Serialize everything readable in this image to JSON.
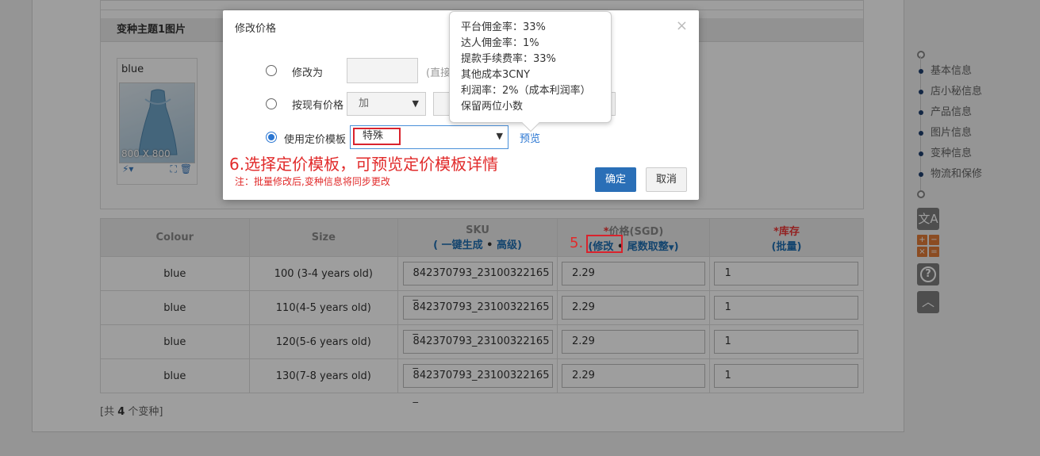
{
  "variant_section": {
    "header": "变种主题1图片",
    "image_card": {
      "label": "blue",
      "size_text": "800 X 800"
    }
  },
  "table": {
    "columns": {
      "colour": "Colour",
      "size": "Size",
      "sku": "SKU",
      "sku_sub_open": "( ",
      "sku_generate": "一键生成",
      "sku_dot": " • ",
      "sku_advanced": "高级",
      "sku_sub_close": ")",
      "price_star": "*",
      "price": "价格(SGD)",
      "price_open": "(",
      "price_edit": "修改",
      "price_dot": " • ",
      "price_round": "尾数取整",
      "price_close": ")",
      "stock_star": "*",
      "stock": "库存",
      "stock_batch": "(批量)"
    },
    "rows": [
      {
        "colour": "blue",
        "size": "100 (3-4 years old)",
        "sku": "842370793_23100322165 _",
        "price": "2.29",
        "stock": "1"
      },
      {
        "colour": "blue",
        "size": "110(4-5 years old)",
        "sku": "842370793_23100322165 _",
        "price": "2.29",
        "stock": "1"
      },
      {
        "colour": "blue",
        "size": "120(5-6 years old)",
        "sku": "842370793_23100322165 _",
        "price": "2.29",
        "stock": "1"
      },
      {
        "colour": "blue",
        "size": "130(7-8 years old)",
        "sku": "842370793_23100322165 _",
        "price": "2.29",
        "stock": "1"
      }
    ],
    "count_prefix": "[共 ",
    "count": "4",
    "count_suffix": " 个变种]"
  },
  "rail": {
    "items": [
      "基本信息",
      "店小秘信息",
      "产品信息",
      "图片信息",
      "变种信息",
      "物流和保修"
    ],
    "translate_icon": "translate-icon",
    "calculator_icon": "calculator-icon",
    "help_icon": "help-icon",
    "top_icon": "back-to-top-icon"
  },
  "modal": {
    "title": "修改价格",
    "close": "×",
    "option_modify": "修改为",
    "option_modify_hint": "(直接",
    "option_by_price": "按现有价格",
    "operator_select": "加",
    "option_template": "使用定价模板",
    "template_value": "特殊",
    "preview": "预览",
    "step6_annotation": "6.选择定价模板，可预览定价模板详情",
    "note": "注：批量修改后,变种信息将同步更改",
    "confirm": "确定",
    "cancel": "取消"
  },
  "tooltip": {
    "lines": [
      "平台佣金率：33%",
      "达人佣金率：1%",
      "提款手续费率：33%",
      "其他成本3CNY",
      "利润率：2%（成本利润率）",
      "保留两位小数"
    ]
  },
  "annotation_step5": "5.",
  "colors": {
    "accent": "#2a76d2",
    "annotation_red": "#e12a2a",
    "confirm_bg": "#2a6fb7"
  }
}
